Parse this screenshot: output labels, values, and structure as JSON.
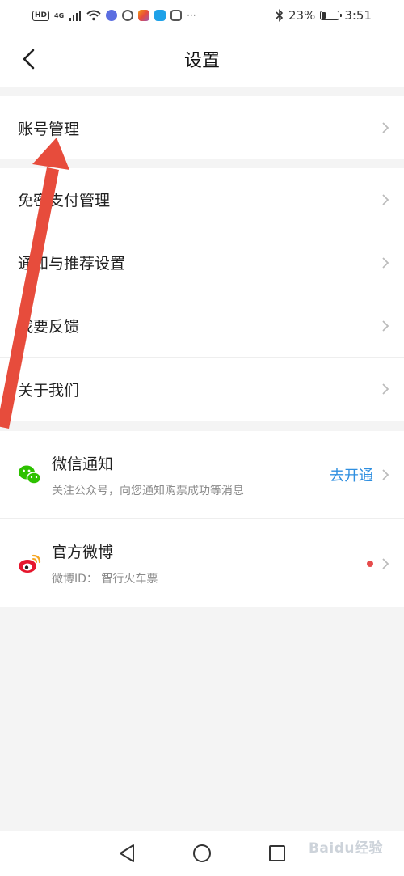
{
  "status_bar": {
    "hd": "HD",
    "network": "4G",
    "battery_percent": "23%",
    "battery_level": 0.23,
    "time": "3:51",
    "more": "···"
  },
  "header": {
    "title": "设置"
  },
  "group1": {
    "items": [
      {
        "label": "账号管理"
      }
    ]
  },
  "group2": {
    "items": [
      {
        "label": "免密支付管理"
      },
      {
        "label": "通知与推荐设置"
      },
      {
        "label": "我要反馈"
      },
      {
        "label": "关于我们"
      }
    ]
  },
  "group3": {
    "wechat": {
      "title": "微信通知",
      "subtitle": "关注公众号，向您通知购票成功等消息",
      "action": "去开通"
    },
    "weibo": {
      "title": "官方微博",
      "subtitle": "微博ID：  智行火车票"
    }
  },
  "colors": {
    "accent": "#2f8fe0",
    "annotation": "#e74c3c",
    "wechat": "#2dc100",
    "weibo": "#e6162d",
    "badge": "#e64b4b"
  },
  "watermark": "Baidu经验"
}
